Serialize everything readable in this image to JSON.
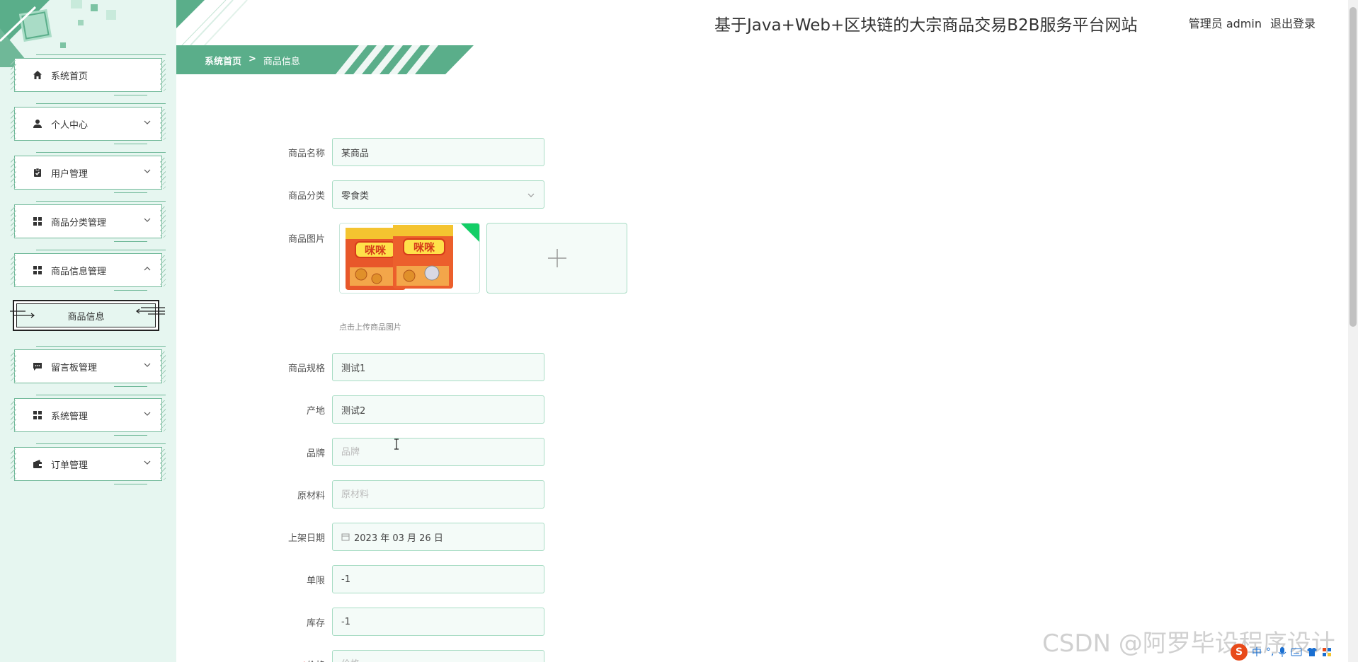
{
  "header": {
    "site_title": "基于Java+Web+区块链的大宗商品交易B2B服务平台网站",
    "user_label": "管理员 admin",
    "logout_label": "退出登录"
  },
  "breadcrumb": {
    "home": "系统首页",
    "separator": ">",
    "current": "商品信息"
  },
  "sidebar": {
    "items": [
      {
        "label": "系统首页",
        "icon": "home-icon"
      },
      {
        "label": "个人中心",
        "icon": "user-icon"
      },
      {
        "label": "用户管理",
        "icon": "clipboard-icon"
      },
      {
        "label": "商品分类管理",
        "icon": "grid-icon"
      },
      {
        "label": "商品信息管理",
        "icon": "grid-icon"
      },
      {
        "label": "留言板管理",
        "icon": "message-icon"
      },
      {
        "label": "系统管理",
        "icon": "grid-icon"
      },
      {
        "label": "订单管理",
        "icon": "wallet-icon"
      }
    ],
    "submenu_item": "商品信息"
  },
  "form": {
    "name_label": "商品名称",
    "name_value": "某商品",
    "category_label": "商品分类",
    "category_value": "零食类",
    "image_label": "商品图片",
    "upload_hint": "点击上传商品图片",
    "spec_label": "商品规格",
    "spec_value": "测试1",
    "origin_label": "产地",
    "origin_value": "测试2",
    "brand_label": "品牌",
    "brand_placeholder": "品牌",
    "material_label": "原材料",
    "material_placeholder": "原材料",
    "date_label": "上架日期",
    "date_value": "2023 年 03 月 26 日",
    "limit_label": "单限",
    "limit_value": "-1",
    "stock_label": "库存",
    "stock_value": "-1",
    "price_label": "价格",
    "price_placeholder": "价格"
  },
  "product_image": {
    "package_text": "咪咪",
    "colors": {
      "bag": "#e8572a",
      "accent": "#f4c430",
      "corner": "#13ce66"
    }
  },
  "watermark": "CSDN @阿罗毕设程序设计",
  "tray": {
    "ime": "中"
  },
  "colors": {
    "sidebar_bg": "#e6f6f0",
    "accent_green": "#5aae8a",
    "input_border": "#a8dcc4"
  }
}
